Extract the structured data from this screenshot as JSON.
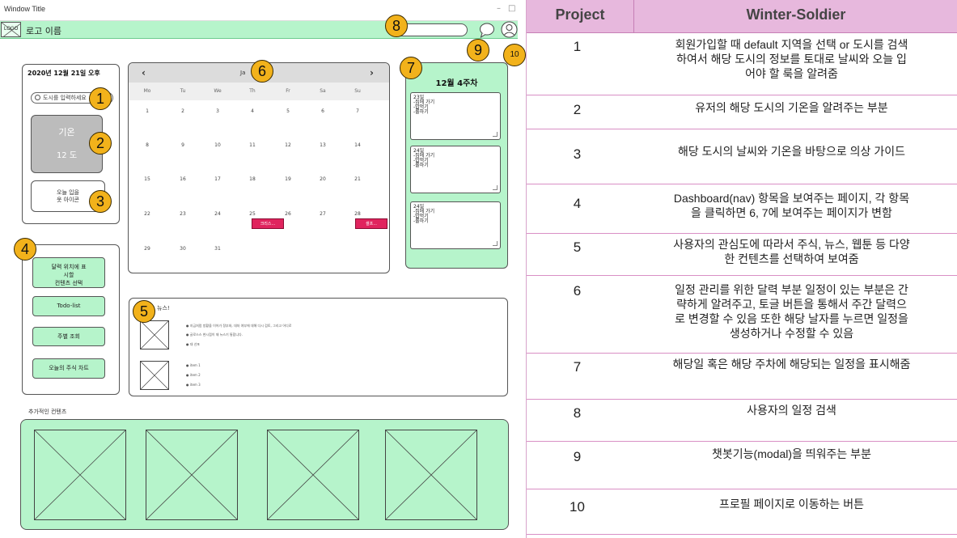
{
  "window": {
    "title": "Window Title",
    "min_glyph": "–",
    "max_glyph": "□"
  },
  "app": {
    "logo_text": "LOGO",
    "logo_name": "로고 이름"
  },
  "badges": [
    "1",
    "2",
    "3",
    "4",
    "5",
    "6",
    "7",
    "8",
    "9",
    "10"
  ],
  "weather": {
    "date_title": "2020년 12월 21일 오후",
    "search_placeholder": "도시를 입력하세요",
    "temp_label": "기온",
    "temp_value": "12 도",
    "outfit_line1": "오늘 입을",
    "outfit_line2": "옷 아이콘"
  },
  "calendar": {
    "prev": "‹",
    "next": "›",
    "month": "Ja",
    "dow": [
      "Mo",
      "Tu",
      "We",
      "Th",
      "Fr",
      "Sa",
      "Su"
    ],
    "weeks": [
      [
        "1",
        "2",
        "3",
        "4",
        "5",
        "6",
        "7"
      ],
      [
        "8",
        "9",
        "10",
        "11",
        "12",
        "13",
        "14"
      ],
      [
        "15",
        "16",
        "17",
        "18",
        "19",
        "20",
        "21"
      ],
      [
        "22",
        "23",
        "24",
        "25",
        "26",
        "27",
        "28"
      ],
      [
        "29",
        "30",
        "31",
        "",
        "",
        "",
        "",
        ""
      ]
    ],
    "events": [
      {
        "label": "크리스..."
      },
      {
        "label": "셀프..."
      }
    ]
  },
  "weekly": {
    "title": "12월 4주차",
    "cards": [
      {
        "day": "23일",
        "items": [
          "-집에 가기",
          "-밥먹기",
          "-롤하기"
        ]
      },
      {
        "day": "24일",
        "items": [
          "-집에 가기",
          "-밥먹기",
          "-롤하기"
        ]
      },
      {
        "day": "24일",
        "items": [
          "-집에 가기",
          "-밥먹기",
          "-롤하기"
        ]
      }
    ]
  },
  "nav": {
    "items": [
      {
        "label1": "달력 위치에 표",
        "label2": "시할",
        "label3": "컨텐츠 선택"
      },
      {
        "label1": "Todo-list"
      },
      {
        "label1": "주별 조회"
      },
      {
        "label1": "오늘의 주식 차트"
      }
    ]
  },
  "recommend": {
    "title": "뉴스!",
    "news1": [
      "● 지금처럼 방황을 이어가 정부와, 대처 여부에 대해 다시 검토, 그리고 어디로",
      "● 글로스스 현시점이 재 뉴스기 통합니다.",
      "● 대 선포"
    ],
    "news2": [
      "● item 1",
      "● item 2",
      "● item 3"
    ]
  },
  "extra": {
    "title": "추가적인 컨텐츠"
  },
  "table": {
    "col1": "Project",
    "col2": "Winter-Soldier",
    "rows": [
      {
        "num": "1",
        "lines": [
          "회원가입할 때 default 지역을 선택 or 도시를 검색",
          "하여서 해당 도시의 정보를 토대로 날씨와 오늘 입",
          "어야 할 룩을 알려줌"
        ]
      },
      {
        "num": "2",
        "lines": [
          "유저의 해당 도시의 기온을 알려주는 부분"
        ]
      },
      {
        "num": "3",
        "lines": [
          "해당 도시의 날씨와 기온을 바탕으로 의상 가이드"
        ]
      },
      {
        "num": "4",
        "lines": [
          "Dashboard(nav) 항목을 보여주는 페이지, 각 항목",
          "을 클릭하면 6, 7에 보여주는 페이지가 변함"
        ]
      },
      {
        "num": "5",
        "lines": [
          "사용자의 관심도에 따라서 주식, 뉴스, 웹툰 등 다양",
          "한 컨텐츠를 선택하여 보여줌"
        ]
      },
      {
        "num": "6",
        "lines": [
          "일정 관리를 위한 달력 부분 일정이 있는 부분은 간",
          "략하게 알려주고, 토글 버튼을 통해서 주간 달력으",
          "로 변경할 수 있음 또한 해당 날자를 누르면 일정을",
          "생성하거나 수정할 수 있음"
        ]
      },
      {
        "num": "7",
        "lines": [
          "해당일 혹은 해당 주차에 해당되는 일정을 표시해줌"
        ]
      },
      {
        "num": "8",
        "lines": [
          "사용자의 일정 검색"
        ]
      },
      {
        "num": "9",
        "lines": [
          "챗봇기능(modal)을 띄워주는 부분"
        ]
      },
      {
        "num": "10",
        "lines": [
          "프로필 페이지로 이동하는 버튼"
        ]
      }
    ]
  }
}
